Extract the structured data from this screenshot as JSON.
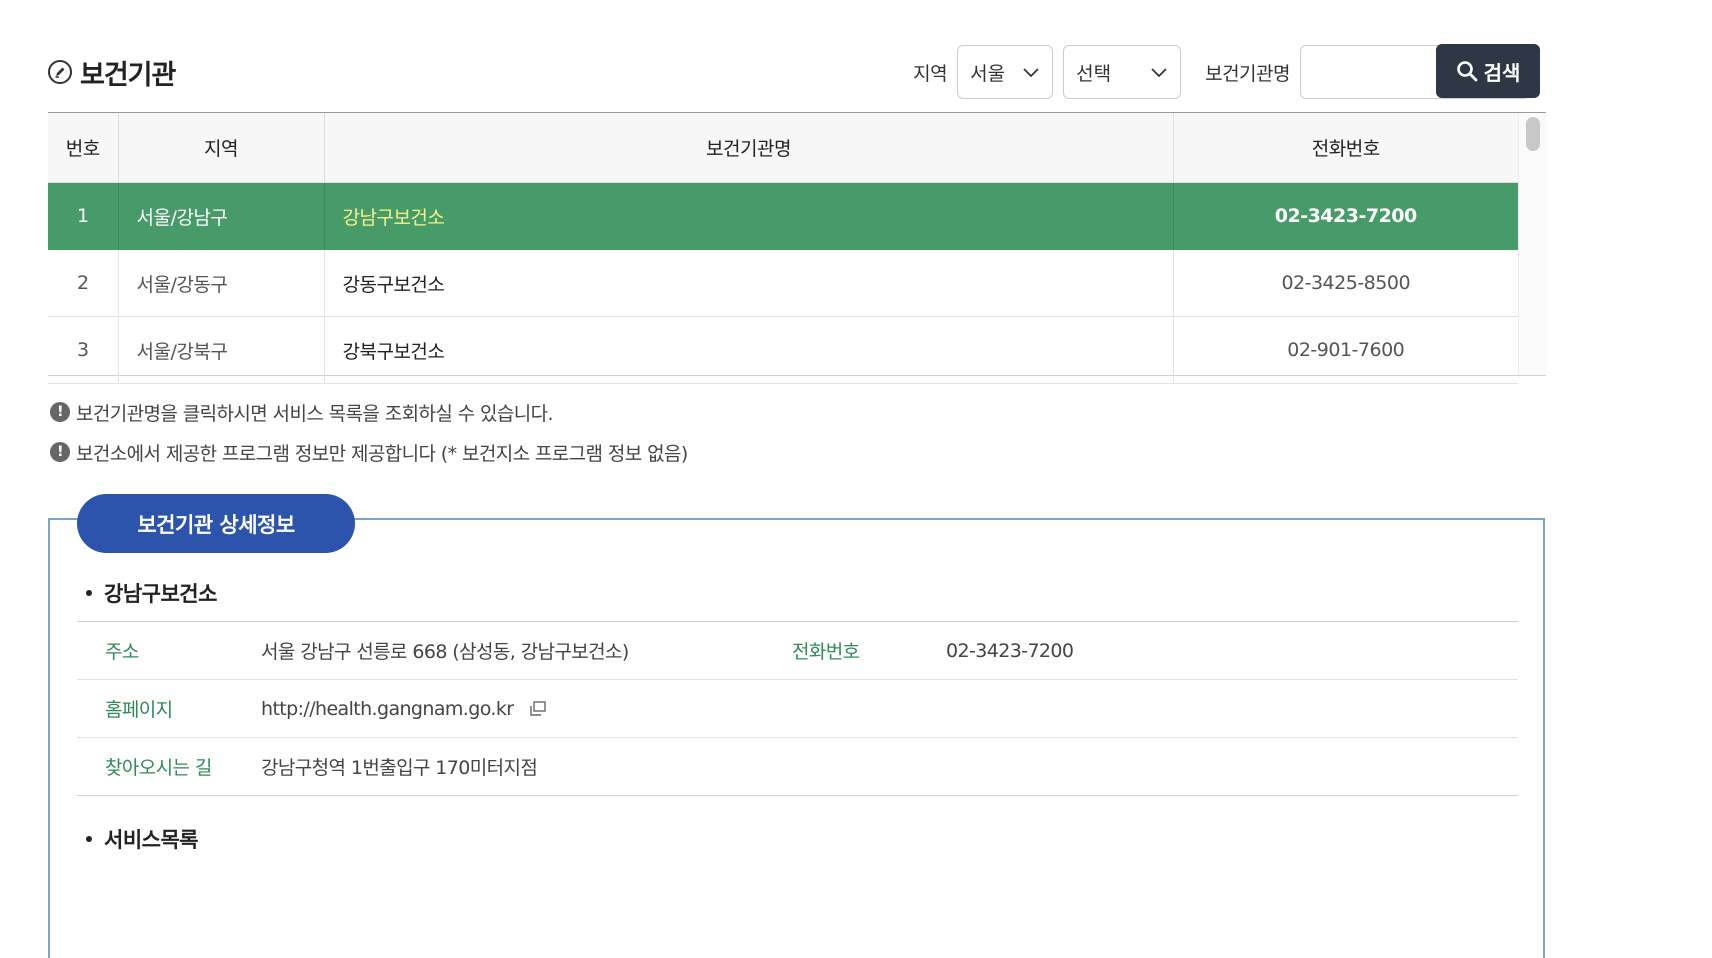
{
  "header": {
    "title": "보건기관",
    "region_label": "지역",
    "region_value": "서울",
    "district_value": "선택",
    "name_label": "보건기관명",
    "name_value": "",
    "search_label": "검색"
  },
  "table": {
    "columns": [
      "번호",
      "지역",
      "보건기관명",
      "전화번호"
    ],
    "rows": [
      {
        "no": "1",
        "region": "서울/강남구",
        "name": "강남구보건소",
        "phone": "02-3423-7200",
        "selected": true
      },
      {
        "no": "2",
        "region": "서울/강동구",
        "name": "강동구보건소",
        "phone": "02-3425-8500",
        "selected": false
      },
      {
        "no": "3",
        "region": "서울/강북구",
        "name": "강북구보건소",
        "phone": "02-901-7600",
        "selected": false
      }
    ]
  },
  "notices": [
    "보건기관명을 클릭하시면 서비스 목록을 조회하실 수 있습니다.",
    "보건소에서 제공한 프로그램 정보만 제공합니다 (* 보건지소 프로그램 정보 없음)"
  ],
  "detail": {
    "tab_label": "보건기관 상세정보",
    "facility_name": "강남구보건소",
    "address_label": "주소",
    "address_value": "서울 강남구 선릉로 668 (삼성동, 강남구보건소)",
    "phone_label": "전화번호",
    "phone_value": "02-3423-7200",
    "homepage_label": "홈페이지",
    "homepage_value": "http://health.gangnam.go.kr",
    "directions_label": "찾아오시는 길",
    "directions_value": "강남구청역 1번출입구 170미터지점",
    "services_heading": "서비스목록"
  },
  "colors": {
    "selected_row": "#479b68",
    "selected_name": "#f7f28a",
    "tab_blue": "#2c54ad",
    "search_button": "#2e3745",
    "label_green": "#2f8a55"
  }
}
